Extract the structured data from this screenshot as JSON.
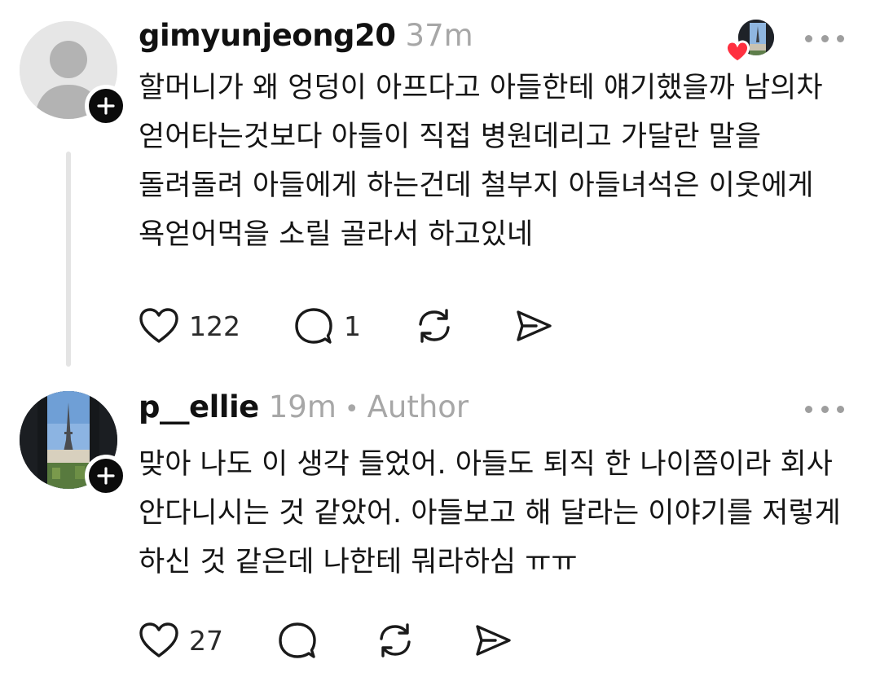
{
  "posts": [
    {
      "username": "gimyunjeong20",
      "time": "37m",
      "text": "할머니가 왜 엉덩이 아프다고 아들한테 얘기했을까 남의차 얻어타는것보다 아들이 직접 병원데리고 가달란 말을 돌려돌려 아들에게 하는건데 철부지 아들녀석은 이웃에게 욕얻어먹을 소릴 골라서 하고있네",
      "likes": "122",
      "replies": "1",
      "avatar_icon": "default-person-icon",
      "liked_by_author": true
    },
    {
      "username": "p__ellie",
      "time": "19m",
      "separator": "•",
      "author_label": "Author",
      "text": "맞아 나도 이 생각 들었어. 아들도 퇴직 한 나이쯤이라 회사 안다니시는 것 같았어. 아들보고 해 달라는 이야기를 저렇게 하신 것 같은데 나한테 뭐라하심 ㅠㅠ",
      "likes": "27",
      "replies": "",
      "avatar_icon": "eiffel-tower-photo"
    }
  ],
  "icons": {
    "like": "heart-outline-icon",
    "reply": "comment-bubble-icon",
    "repost": "repost-arrows-icon",
    "share": "send-paper-plane-icon",
    "more": "more-dots-icon",
    "follow": "plus-icon"
  },
  "colors": {
    "heart_badge": "#ff3040",
    "meta_gray": "#a7a7a7",
    "text": "#151515"
  }
}
